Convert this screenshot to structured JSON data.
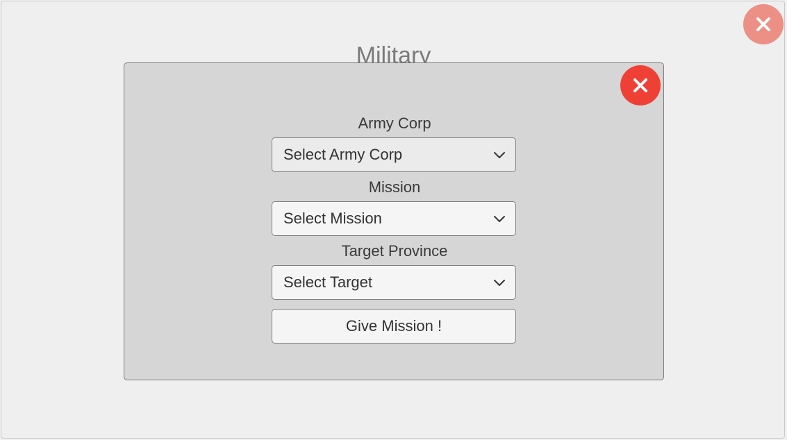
{
  "background": {
    "title": "Military"
  },
  "modal": {
    "army": {
      "label": "Army Corp",
      "selected": "Select Army Corp"
    },
    "mission": {
      "label": "Mission",
      "selected": "Select Mission"
    },
    "target": {
      "label": "Target Province",
      "selected": "Select Target"
    },
    "submit_label": "Give Mission !"
  },
  "icons": {
    "close": "close-icon",
    "dropdown": "chevron-down-icon"
  },
  "colors": {
    "close_outer": "#ec8f85",
    "close_inner": "#ef4036",
    "panel": "#d6d6d6",
    "window": "#efefef"
  }
}
